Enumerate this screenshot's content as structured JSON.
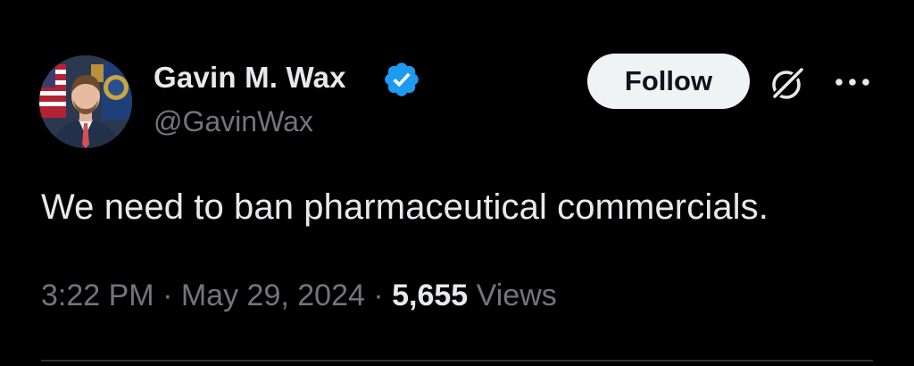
{
  "author": {
    "display_name": "Gavin M. Wax",
    "handle": "@GavinWax",
    "verified": true,
    "verified_color": "#1d9bf0"
  },
  "actions": {
    "follow_label": "Follow",
    "grok_icon": "grok-icon",
    "more_icon": "more-horizontal-icon"
  },
  "tweet": {
    "text": "We need to ban pharmaceutical commercials.",
    "time": "3:22 PM",
    "separator": "·",
    "date": "May 29, 2024",
    "views_count": "5,655",
    "views_label": "Views"
  },
  "theme": {
    "background": "#000000",
    "primary_text": "#e7e9ea",
    "secondary_text": "#71767b",
    "follow_bg": "#eff3f4"
  }
}
